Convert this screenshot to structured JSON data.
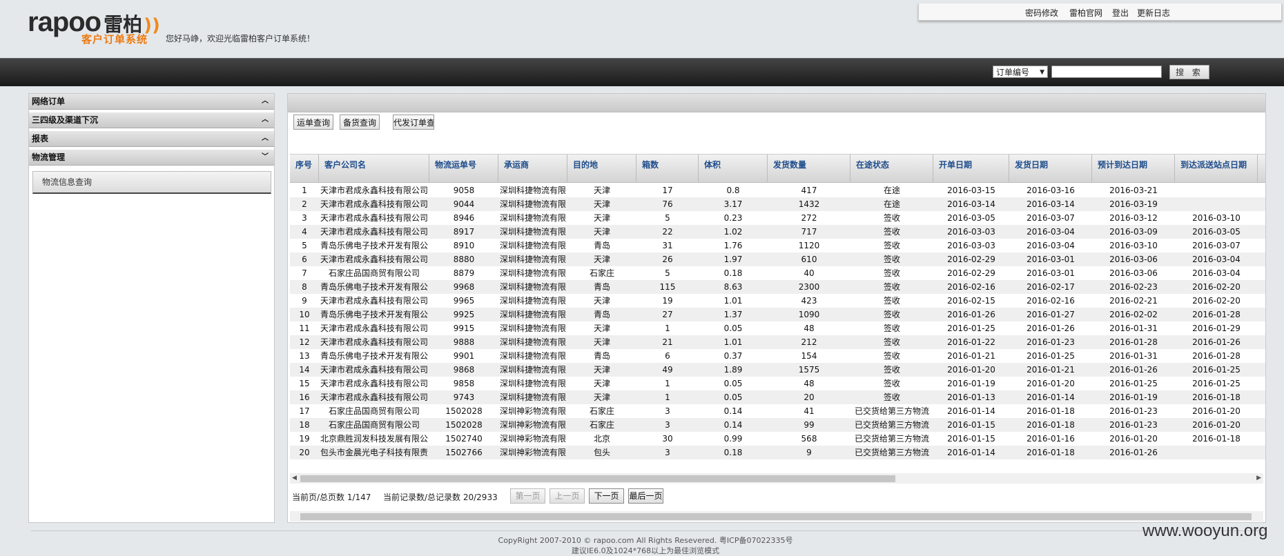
{
  "header": {
    "logo_text": "rapoo",
    "logo_cn": "雷柏",
    "logo_waves": "))",
    "system_name": "客户订单系统",
    "welcome": "您好马峥，欢迎光临雷柏客户订单系统！",
    "links": [
      "密码修改",
      "雷柏官网",
      "登出",
      "更新日志"
    ]
  },
  "search": {
    "selected_option": "订单编号",
    "input_value": "",
    "button_label": "搜 索"
  },
  "sidebar": {
    "sections": [
      {
        "label": "网络订单",
        "chevron": "up"
      },
      {
        "label": "三四级及渠道下沉",
        "chevron": "up"
      },
      {
        "label": "报表",
        "chevron": "up"
      },
      {
        "label": "物流管理",
        "chevron": "down"
      }
    ],
    "active_item": "物流信息查询"
  },
  "toolbar": {
    "buttons": [
      "运单查询",
      "备货查询",
      "代发订单查"
    ]
  },
  "table": {
    "headers": [
      "序号",
      "客户公司名",
      "物流运单号",
      "承运商",
      "目的地",
      "箱数",
      "体积",
      "发货数量",
      "在途状态",
      "开单日期",
      "发货日期",
      "预计到达日期",
      "到达派送站点日期"
    ],
    "rows": [
      [
        "1",
        "天津市君成永鑫科技有限公司",
        "9058",
        "深圳科捷物流有限",
        "天津",
        "17",
        "0.8",
        "417",
        "在途",
        "2016-03-15",
        "2016-03-16",
        "2016-03-21",
        ""
      ],
      [
        "2",
        "天津市君成永鑫科技有限公司",
        "9044",
        "深圳科捷物流有限",
        "天津",
        "76",
        "3.17",
        "1432",
        "在途",
        "2016-03-14",
        "2016-03-14",
        "2016-03-19",
        ""
      ],
      [
        "3",
        "天津市君成永鑫科技有限公司",
        "8946",
        "深圳科捷物流有限",
        "天津",
        "5",
        "0.23",
        "272",
        "签收",
        "2016-03-05",
        "2016-03-07",
        "2016-03-12",
        "2016-03-10"
      ],
      [
        "4",
        "天津市君成永鑫科技有限公司",
        "8917",
        "深圳科捷物流有限",
        "天津",
        "22",
        "1.02",
        "717",
        "签收",
        "2016-03-03",
        "2016-03-04",
        "2016-03-09",
        "2016-03-05"
      ],
      [
        "5",
        "青岛乐佛电子技术开发有限公",
        "8910",
        "深圳科捷物流有限",
        "青岛",
        "31",
        "1.76",
        "1120",
        "签收",
        "2016-03-03",
        "2016-03-04",
        "2016-03-10",
        "2016-03-07"
      ],
      [
        "6",
        "天津市君成永鑫科技有限公司",
        "8880",
        "深圳科捷物流有限",
        "天津",
        "26",
        "1.97",
        "610",
        "签收",
        "2016-02-29",
        "2016-03-01",
        "2016-03-06",
        "2016-03-04"
      ],
      [
        "7",
        "石家庄品国商贸有限公司",
        "8879",
        "深圳科捷物流有限",
        "石家庄",
        "5",
        "0.18",
        "40",
        "签收",
        "2016-02-29",
        "2016-03-01",
        "2016-03-06",
        "2016-03-04"
      ],
      [
        "8",
        "青岛乐佛电子技术开发有限公",
        "9968",
        "深圳科捷物流有限",
        "青岛",
        "115",
        "8.63",
        "2300",
        "签收",
        "2016-02-16",
        "2016-02-17",
        "2016-02-23",
        "2016-02-20"
      ],
      [
        "9",
        "天津市君成永鑫科技有限公司",
        "9965",
        "深圳科捷物流有限",
        "天津",
        "19",
        "1.01",
        "423",
        "签收",
        "2016-02-15",
        "2016-02-16",
        "2016-02-21",
        "2016-02-20"
      ],
      [
        "10",
        "青岛乐佛电子技术开发有限公",
        "9925",
        "深圳科捷物流有限",
        "青岛",
        "27",
        "1.37",
        "1090",
        "签收",
        "2016-01-26",
        "2016-01-27",
        "2016-02-02",
        "2016-01-28"
      ],
      [
        "11",
        "天津市君成永鑫科技有限公司",
        "9915",
        "深圳科捷物流有限",
        "天津",
        "1",
        "0.05",
        "48",
        "签收",
        "2016-01-25",
        "2016-01-26",
        "2016-01-31",
        "2016-01-29"
      ],
      [
        "12",
        "天津市君成永鑫科技有限公司",
        "9888",
        "深圳科捷物流有限",
        "天津",
        "21",
        "1.01",
        "212",
        "签收",
        "2016-01-22",
        "2016-01-23",
        "2016-01-28",
        "2016-01-26"
      ],
      [
        "13",
        "青岛乐佛电子技术开发有限公",
        "9901",
        "深圳科捷物流有限",
        "青岛",
        "6",
        "0.37",
        "154",
        "签收",
        "2016-01-21",
        "2016-01-25",
        "2016-01-31",
        "2016-01-28"
      ],
      [
        "14",
        "天津市君成永鑫科技有限公司",
        "9868",
        "深圳科捷物流有限",
        "天津",
        "49",
        "1.89",
        "1575",
        "签收",
        "2016-01-20",
        "2016-01-21",
        "2016-01-26",
        "2016-01-25"
      ],
      [
        "15",
        "天津市君成永鑫科技有限公司",
        "9858",
        "深圳科捷物流有限",
        "天津",
        "1",
        "0.05",
        "48",
        "签收",
        "2016-01-19",
        "2016-01-20",
        "2016-01-25",
        "2016-01-25"
      ],
      [
        "16",
        "天津市君成永鑫科技有限公司",
        "9743",
        "深圳科捷物流有限",
        "天津",
        "1",
        "0.05",
        "20",
        "签收",
        "2016-01-13",
        "2016-01-14",
        "2016-01-19",
        "2016-01-18"
      ],
      [
        "17",
        "石家庄品国商贸有限公司",
        "1502028",
        "深圳神彩物流有限",
        "石家庄",
        "3",
        "0.14",
        "41",
        "已交货给第三方物流",
        "2016-01-14",
        "2016-01-18",
        "2016-01-23",
        "2016-01-20"
      ],
      [
        "18",
        "石家庄品国商贸有限公司",
        "1502028",
        "深圳神彩物流有限",
        "石家庄",
        "3",
        "0.14",
        "99",
        "已交货给第三方物流",
        "2016-01-15",
        "2016-01-18",
        "2016-01-23",
        "2016-01-20"
      ],
      [
        "19",
        "北京鼎胜润发科技发展有限公",
        "1502740",
        "深圳神彩物流有限",
        "北京",
        "30",
        "0.99",
        "568",
        "已交货给第三方物流",
        "2016-01-15",
        "2016-01-16",
        "2016-01-20",
        "2016-01-18"
      ],
      [
        "20",
        "包头市金晨光电子科技有限责",
        "1502766",
        "深圳神彩物流有限",
        "包头",
        "3",
        "0.18",
        "9",
        "已交货给第三方物流",
        "2016-01-14",
        "2016-01-18",
        "2016-01-26",
        ""
      ]
    ]
  },
  "pager": {
    "page_info": "当前页/总页数 1/147",
    "record_info": "当前记录数/总记录数 20/2933",
    "first": "第一页",
    "prev": "上一页",
    "next": "下一页",
    "last": "最后一页"
  },
  "footer": {
    "copyright": "CopyRight 2007-2010 © rapoo.com All Rights Resevered. 粤ICP备07022335号",
    "browser_tip": "建议IE6.0及1024*768以上为最佳浏览模式"
  },
  "watermark": "www.wooyun.org",
  "colors": {
    "brand_orange": "#ee7a10",
    "header_link_blue": "#1e4d8c",
    "page_bg": "#e4e8eb",
    "topbar_dark": "#1a1a1a"
  },
  "icons": {
    "select_arrow": "caret-down-icon",
    "section_collapse": "chevron-up-icon",
    "section_expand": "chevron-down-icon",
    "scroll_left": "scroll-left-arrow-icon",
    "scroll_right": "scroll-right-arrow-icon"
  }
}
